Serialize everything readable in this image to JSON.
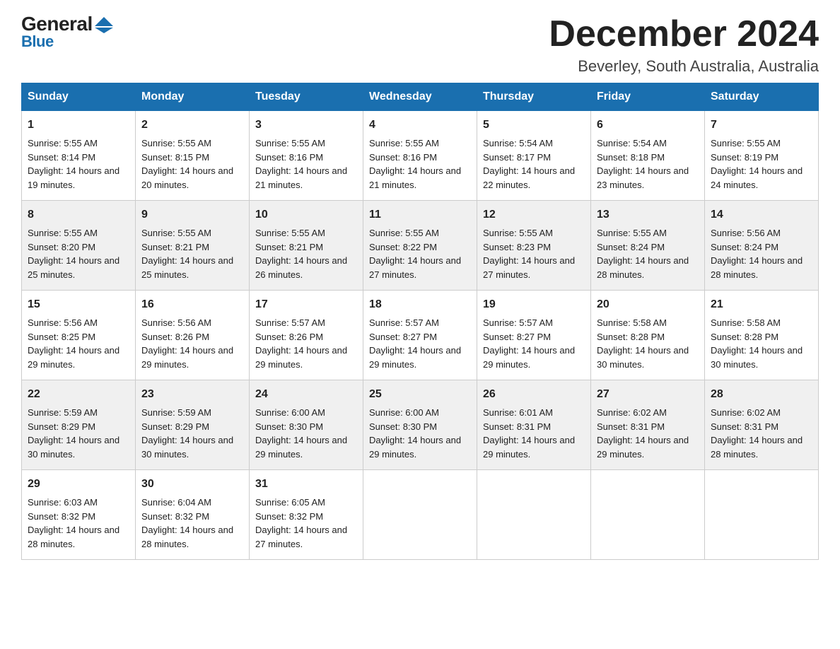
{
  "header": {
    "month_title": "December 2024",
    "location": "Beverley, South Australia, Australia",
    "logo_top": "General",
    "logo_bottom": "Blue"
  },
  "days_of_week": [
    "Sunday",
    "Monday",
    "Tuesday",
    "Wednesday",
    "Thursday",
    "Friday",
    "Saturday"
  ],
  "weeks": [
    [
      {
        "day": "1",
        "sunrise": "5:55 AM",
        "sunset": "8:14 PM",
        "daylight": "14 hours and 19 minutes."
      },
      {
        "day": "2",
        "sunrise": "5:55 AM",
        "sunset": "8:15 PM",
        "daylight": "14 hours and 20 minutes."
      },
      {
        "day": "3",
        "sunrise": "5:55 AM",
        "sunset": "8:16 PM",
        "daylight": "14 hours and 21 minutes."
      },
      {
        "day": "4",
        "sunrise": "5:55 AM",
        "sunset": "8:16 PM",
        "daylight": "14 hours and 21 minutes."
      },
      {
        "day": "5",
        "sunrise": "5:54 AM",
        "sunset": "8:17 PM",
        "daylight": "14 hours and 22 minutes."
      },
      {
        "day": "6",
        "sunrise": "5:54 AM",
        "sunset": "8:18 PM",
        "daylight": "14 hours and 23 minutes."
      },
      {
        "day": "7",
        "sunrise": "5:55 AM",
        "sunset": "8:19 PM",
        "daylight": "14 hours and 24 minutes."
      }
    ],
    [
      {
        "day": "8",
        "sunrise": "5:55 AM",
        "sunset": "8:20 PM",
        "daylight": "14 hours and 25 minutes."
      },
      {
        "day": "9",
        "sunrise": "5:55 AM",
        "sunset": "8:21 PM",
        "daylight": "14 hours and 25 minutes."
      },
      {
        "day": "10",
        "sunrise": "5:55 AM",
        "sunset": "8:21 PM",
        "daylight": "14 hours and 26 minutes."
      },
      {
        "day": "11",
        "sunrise": "5:55 AM",
        "sunset": "8:22 PM",
        "daylight": "14 hours and 27 minutes."
      },
      {
        "day": "12",
        "sunrise": "5:55 AM",
        "sunset": "8:23 PM",
        "daylight": "14 hours and 27 minutes."
      },
      {
        "day": "13",
        "sunrise": "5:55 AM",
        "sunset": "8:24 PM",
        "daylight": "14 hours and 28 minutes."
      },
      {
        "day": "14",
        "sunrise": "5:56 AM",
        "sunset": "8:24 PM",
        "daylight": "14 hours and 28 minutes."
      }
    ],
    [
      {
        "day": "15",
        "sunrise": "5:56 AM",
        "sunset": "8:25 PM",
        "daylight": "14 hours and 29 minutes."
      },
      {
        "day": "16",
        "sunrise": "5:56 AM",
        "sunset": "8:26 PM",
        "daylight": "14 hours and 29 minutes."
      },
      {
        "day": "17",
        "sunrise": "5:57 AM",
        "sunset": "8:26 PM",
        "daylight": "14 hours and 29 minutes."
      },
      {
        "day": "18",
        "sunrise": "5:57 AM",
        "sunset": "8:27 PM",
        "daylight": "14 hours and 29 minutes."
      },
      {
        "day": "19",
        "sunrise": "5:57 AM",
        "sunset": "8:27 PM",
        "daylight": "14 hours and 29 minutes."
      },
      {
        "day": "20",
        "sunrise": "5:58 AM",
        "sunset": "8:28 PM",
        "daylight": "14 hours and 30 minutes."
      },
      {
        "day": "21",
        "sunrise": "5:58 AM",
        "sunset": "8:28 PM",
        "daylight": "14 hours and 30 minutes."
      }
    ],
    [
      {
        "day": "22",
        "sunrise": "5:59 AM",
        "sunset": "8:29 PM",
        "daylight": "14 hours and 30 minutes."
      },
      {
        "day": "23",
        "sunrise": "5:59 AM",
        "sunset": "8:29 PM",
        "daylight": "14 hours and 30 minutes."
      },
      {
        "day": "24",
        "sunrise": "6:00 AM",
        "sunset": "8:30 PM",
        "daylight": "14 hours and 29 minutes."
      },
      {
        "day": "25",
        "sunrise": "6:00 AM",
        "sunset": "8:30 PM",
        "daylight": "14 hours and 29 minutes."
      },
      {
        "day": "26",
        "sunrise": "6:01 AM",
        "sunset": "8:31 PM",
        "daylight": "14 hours and 29 minutes."
      },
      {
        "day": "27",
        "sunrise": "6:02 AM",
        "sunset": "8:31 PM",
        "daylight": "14 hours and 29 minutes."
      },
      {
        "day": "28",
        "sunrise": "6:02 AM",
        "sunset": "8:31 PM",
        "daylight": "14 hours and 28 minutes."
      }
    ],
    [
      {
        "day": "29",
        "sunrise": "6:03 AM",
        "sunset": "8:32 PM",
        "daylight": "14 hours and 28 minutes."
      },
      {
        "day": "30",
        "sunrise": "6:04 AM",
        "sunset": "8:32 PM",
        "daylight": "14 hours and 28 minutes."
      },
      {
        "day": "31",
        "sunrise": "6:05 AM",
        "sunset": "8:32 PM",
        "daylight": "14 hours and 27 minutes."
      },
      null,
      null,
      null,
      null
    ]
  ],
  "labels": {
    "sunrise_prefix": "Sunrise: ",
    "sunset_prefix": "Sunset: ",
    "daylight_prefix": "Daylight: "
  }
}
